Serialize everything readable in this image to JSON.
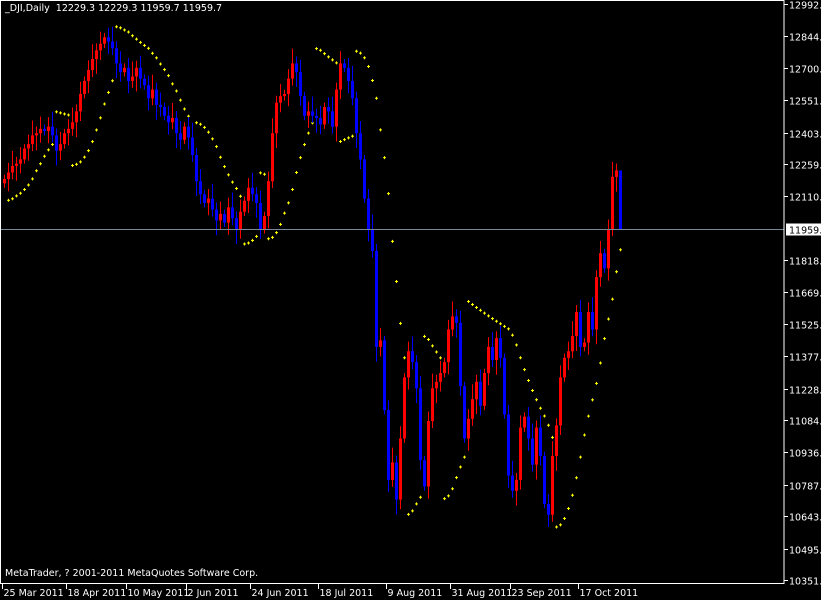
{
  "header": {
    "symbol": "_DJI,Daily",
    "open": "12229.3",
    "high": "12229.3",
    "low": "11959.7",
    "close": "11959.7"
  },
  "copyright": "MetaTrader, ? 2001-2011 MetaQuotes Software Corp.",
  "colors": {
    "background": "#000000",
    "bull": "#ff0000",
    "bear": "#0000ff",
    "sar": "#ffff00",
    "price_line": "#778899",
    "axis": "#ffffff"
  },
  "chart_data": {
    "type": "candlestick",
    "title": "_DJI,Daily",
    "indicator": "Parabolic SAR",
    "current_price": "11959.7",
    "ylim": [
      10351.0,
      12992.5
    ],
    "y_ticks": [
      "12992.5",
      "12844.0",
      "12700.0",
      "12551.5",
      "12403.0",
      "12259.0",
      "12110.5",
      "11818.0",
      "11669.5",
      "11525.5",
      "11377.0",
      "11228.5",
      "11084.5",
      "10936.0",
      "10787.5",
      "10643.5",
      "10495.0",
      "10351.0"
    ],
    "x_ticks": [
      {
        "bar": 0,
        "label": "25 Mar 2011"
      },
      {
        "bar": 16,
        "label": "18 Apr 2011"
      },
      {
        "bar": 31,
        "label": "10 May 2011"
      },
      {
        "bar": 46,
        "label": "2 Jun 2011"
      },
      {
        "bar": 62,
        "label": "24 Jun 2011"
      },
      {
        "bar": 79,
        "label": "18 Jul 2011"
      },
      {
        "bar": 96,
        "label": "9 Aug 2011"
      },
      {
        "bar": 112,
        "label": "31 Aug 2011"
      },
      {
        "bar": 127,
        "label": "23 Sep 2011"
      },
      {
        "bar": 144,
        "label": "17 Oct 2011"
      }
    ],
    "first_open": 12170,
    "closes": [
      12190,
      12220,
      12250,
      12260,
      12280,
      12330,
      12350,
      12390,
      12400,
      12420,
      12410,
      12430,
      12390,
      12320,
      12350,
      12400,
      12420,
      12450,
      12500,
      12580,
      12640,
      12690,
      12740,
      12780,
      12810,
      12840,
      12820,
      12790,
      12720,
      12680,
      12700,
      12640,
      12660,
      12700,
      12650,
      12620,
      12560,
      12600,
      12530,
      12520,
      12480,
      12450,
      12470,
      12400,
      12370,
      12430,
      12380,
      12300,
      12180,
      12120,
      12080,
      12100,
      12050,
      12000,
      12030,
      11990,
      12060,
      12010,
      11960,
      12040,
      12090,
      12150,
      12120,
      12080,
      11960,
      12020,
      12180,
      12400,
      12540,
      12570,
      12580,
      12650,
      12720,
      12680,
      12570,
      12480,
      12500,
      12480,
      12470,
      12440,
      12520,
      12500,
      12430,
      12600,
      12720,
      12700,
      12640,
      12560,
      12400,
      12280,
      12100,
      11960,
      11860,
      11420,
      11450,
      11130,
      10810,
      10890,
      10720,
      11000,
      11280,
      11400,
      11350,
      11230,
      10900,
      10780,
      11080,
      11230,
      11260,
      11300,
      11350,
      11500,
      11560,
      11530,
      11240,
      11000,
      11090,
      11180,
      11260,
      11150,
      11300,
      11420,
      11360,
      11460,
      11370,
      11110,
      10830,
      10760,
      10810,
      11050,
      11100,
      11000,
      10880,
      11050,
      10920,
      10700,
      10650,
      10920,
      11060,
      11280,
      11370,
      11400,
      11470,
      11580,
      11420,
      11440,
      11580,
      11500,
      11740,
      11850,
      11780,
      11960,
      12200,
      12229.3,
      11959.7
    ],
    "last_bar": {
      "open": 12229.3,
      "high": 12229.3,
      "low": 11959.7,
      "close": 11959.7
    }
  }
}
